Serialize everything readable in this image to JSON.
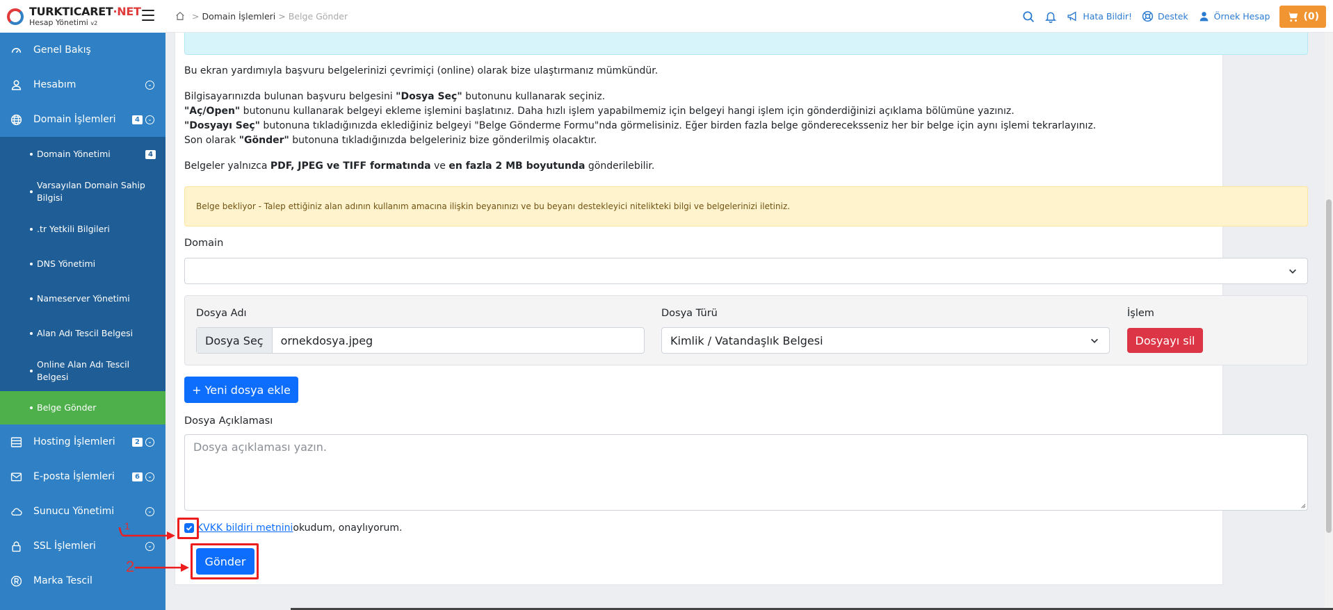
{
  "logo": {
    "brand_main": "TURKTICARET",
    "brand_net": "·NET",
    "subtitle": "Hesap Yönetimi",
    "version": "v2"
  },
  "sidebar": {
    "items": [
      {
        "label": "Genel Bakış",
        "icon": "dashboard-icon"
      },
      {
        "label": "Hesabım",
        "icon": "user-icon"
      },
      {
        "label": "Domain İşlemleri",
        "icon": "globe-icon",
        "badge": "4"
      }
    ],
    "sub_items": [
      {
        "label": "Domain Yönetimi",
        "badge": "4"
      },
      {
        "label": "Varsayılan Domain Sahip Bilgisi"
      },
      {
        "label": ".tr Yetkili Bilgileri"
      },
      {
        "label": "DNS Yönetimi"
      },
      {
        "label": "Nameserver Yönetimi"
      },
      {
        "label": "Alan Adı Tescil Belgesi"
      },
      {
        "label": "Online Alan Adı Tescil Belgesi"
      },
      {
        "label": "Belge Gönder",
        "active": true
      }
    ],
    "items_after": [
      {
        "label": "Hosting İşlemleri",
        "icon": "server-icon",
        "badge": "2"
      },
      {
        "label": "E-posta İşlemleri",
        "icon": "mail-icon",
        "badge": "6"
      },
      {
        "label": "Sunucu Yönetimi",
        "icon": "cloud-icon"
      },
      {
        "label": "SSL İşlemleri",
        "icon": "lock-icon"
      },
      {
        "label": "Marka Tescil",
        "icon": "registered-icon"
      }
    ]
  },
  "topbar": {
    "breadcrumb": [
      "Domain İşlemleri",
      "Belge Gönder"
    ],
    "report_bug": "Hata Bildir!",
    "support": "Destek",
    "account": "Örnek Hesap",
    "cart": "(0)"
  },
  "content": {
    "intro": "Bu ekran yardımıyla başvuru belgelerinizi çevrimiçi (online) olarak bize ulaştırmanız mümkündür.",
    "step1_a": "Bilgisayarınızda bulunan başvuru belgesini ",
    "step1_b": "\"Dosya Seç\"",
    "step1_c": " butonunu kullanarak seçiniz.",
    "step2_a": "\"Aç/Open\"",
    "step2_b": " butonunu kullanarak belgeyi ekleme işlemini başlatınız. Daha hızlı işlem yapabilmemiz için belgeyi hangi işlem için gönderdiğinizi açıklama bölümüne yazınız.",
    "step3_a": "\"Dosyayı Seç\"",
    "step3_b": " butonuna tıkladığınızda eklediğiniz belgeyi \"Belge Gönderme Formu\"nda görmelisiniz. Eğer birden fazla belge göndereceksseniz her bir belge için aynı işlemi tekrarlayınız.",
    "step4_a": "Son olarak ",
    "step4_b": "\"Gönder\"",
    "step4_c": " butonuna tıkladığınızda belgeleriniz bize gönderilmiş olacaktır.",
    "formats_a": "Belgeler yalnızca ",
    "formats_b": "PDF, JPEG ve TIFF formatında",
    "formats_c": " ve ",
    "formats_d": "en fazla 2 MB boyutunda",
    "formats_e": " gönderilebilir.",
    "warning": "Belge bekliyor - Talep ettiğiniz alan adının kullanım amacına ilişkin beyanınızı ve bu beyanı destekleyici nitelikteki bilgi ve belgelerinizi iletiniz.",
    "domain_label": "Domain",
    "domain_value": "",
    "file_name_label": "Dosya Adı",
    "choose_file_btn": "Dosya Seç",
    "file_name_value": "ornekdosya.jpeg",
    "file_type_label": "Dosya Türü",
    "file_type_value": "Kimlik / Vatandaşlık Belgesi",
    "action_label": "İşlem",
    "delete_btn": "Dosyayı sil",
    "add_file_btn": "+ Yeni dosya ekle",
    "desc_label": "Dosya Açıklaması",
    "desc_placeholder": "Dosya açıklaması yazın.",
    "consent_link": "KVKK bildiri metnini",
    "consent_text": " okudum, onaylıyorum.",
    "submit_btn": "Gönder"
  },
  "annotations": {
    "num1": "1",
    "num2": "2"
  },
  "colors": {
    "sidebar": "#2f80c4",
    "sub_sidebar": "#1e5d96",
    "active": "#4db04a",
    "primary": "#0d6efd",
    "danger": "#dc3545",
    "cart": "#f19532",
    "annotation": "#ee1d1d"
  }
}
